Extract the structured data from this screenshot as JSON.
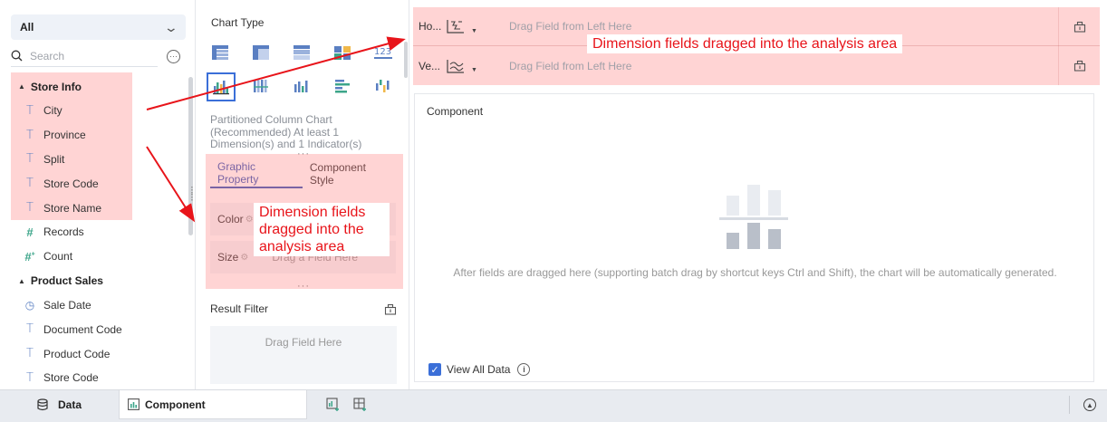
{
  "dataset_select": {
    "value": "All"
  },
  "search": {
    "placeholder": "Search"
  },
  "field_groups": [
    {
      "name": "Store Info",
      "fields": [
        {
          "label": "City",
          "type": "text"
        },
        {
          "label": "Province",
          "type": "text"
        },
        {
          "label": "Split",
          "type": "text"
        },
        {
          "label": "Store Code",
          "type": "text"
        },
        {
          "label": "Store Name",
          "type": "text"
        },
        {
          "label": "Records",
          "type": "number"
        },
        {
          "label": "Count",
          "type": "number-calc"
        }
      ]
    },
    {
      "name": "Product Sales",
      "fields": [
        {
          "label": "Sale Date",
          "type": "date"
        },
        {
          "label": "Document Code",
          "type": "text"
        },
        {
          "label": "Product Code",
          "type": "text"
        },
        {
          "label": "Store Code",
          "type": "text"
        }
      ]
    }
  ],
  "chart_type": {
    "title": "Chart Type",
    "selected_description": "Partitioned Column Chart (Recommended) At least 1 Dimension(s) and 1 Indicator(s)"
  },
  "property_tabs": [
    "Graphic Property",
    "Component Style"
  ],
  "properties": [
    {
      "label": "Color",
      "placeholder": ""
    },
    {
      "label": "Size",
      "placeholder": "Drag a Field Here"
    }
  ],
  "result_filter": {
    "title": "Result Filter",
    "placeholder": "Drag Field Here"
  },
  "axes": [
    {
      "label": "Ho...",
      "placeholder": "Drag Field from Left Here"
    },
    {
      "label": "Ve...",
      "placeholder": "Drag Field from Left Here"
    }
  ],
  "component": {
    "title": "Component",
    "empty_hint": "After fields are dragged here (supporting batch drag by shortcut keys Ctrl and Shift), the chart will be automatically generated.",
    "view_all_label": "View All Data",
    "view_all_checked": true
  },
  "annotations": {
    "top_callout": "Dimension fields dragged into the analysis area",
    "mid_callout_1": "Dimension fields",
    "mid_callout_2": "dragged into the",
    "mid_callout_3": "analysis area",
    "color": "#e8141a"
  },
  "bottom_tabs": {
    "data_label": "Data",
    "component_label": "Component"
  },
  "colors": {
    "accent": "#3b6fd8",
    "highlight": "rgba(255,120,120,0.32)",
    "number_field": "#3ca58a"
  }
}
